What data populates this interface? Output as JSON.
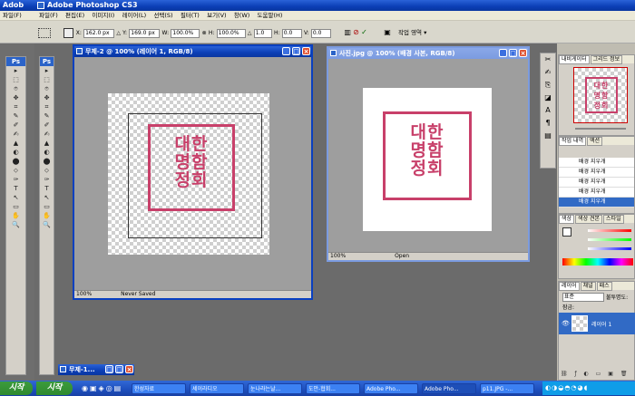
{
  "app_title": "Adobe Photoshop CS3",
  "left_app_title": "Adob",
  "left_app_menu": "파일(F)",
  "menu": [
    "파일(F)",
    "편집(E)",
    "이미지(I)",
    "레이어(L)",
    "선택(S)",
    "필터(T)",
    "보기(V)",
    "창(W)",
    "도움말(H)"
  ],
  "options": {
    "x_label": "X:",
    "x_value": "162.0 px",
    "y_label": "Y:",
    "y_value": "169.0 px",
    "w_label": "W:",
    "w_value": "100.0%",
    "h_label": "H:",
    "h_value": "100.0%",
    "angle_value": "1.0",
    "hskew_label": "H:",
    "hskew_value": "0.0",
    "vskew_label": "V:",
    "vskew_value": "0.0",
    "workspace_label": "작업 영역 ▾"
  },
  "ps_logo": "Ps",
  "tools": [
    "▸",
    "⬚",
    "⌾",
    "✥",
    "⌗",
    "✎",
    "✐",
    "✍",
    "▲",
    "◐",
    "⬤",
    "⬦",
    "✑",
    "T",
    "↖",
    "▭",
    "✋",
    "🔍"
  ],
  "doc1": {
    "title": "무제-2 @ 100% (레이어 1, RGB/8)",
    "zoom": "100%",
    "status": "Never Saved"
  },
  "doc2": {
    "title": "사진.jpg @ 100% (배경 사본, RGB/8)",
    "zoom": "100%",
    "status": "Open"
  },
  "seal_lines": [
    "대한",
    "명함",
    "정회"
  ],
  "minimized_doc": "무제-1...",
  "navigator": {
    "tabs": [
      "내비게이터",
      "그리드 정보"
    ]
  },
  "history": {
    "tabs": [
      "작업 내역",
      "액션"
    ],
    "items": [
      "배경 지우개",
      "배경 지우개",
      "배경 지우개",
      "배경 지우개",
      "배경 지우개"
    ],
    "selected_index": 4
  },
  "color_panel": {
    "tabs": [
      "색상",
      "색상 견본",
      "스타일"
    ]
  },
  "layers": {
    "tabs": [
      "레이어",
      "채널",
      "패스"
    ],
    "blend_mode": "표준",
    "opacity_label": "불투명도:",
    "lock_label": "잠금:",
    "layer_name": "레이어 1"
  },
  "taskbar": {
    "start_left": "시작",
    "start": "시작",
    "items": [
      "한성자료",
      "세이라디오",
      "눈나라는날...",
      "도안-협회...",
      "Adobe Pho...",
      "Adobe Pho...",
      "p11.JPG -..."
    ],
    "active_index": 5
  },
  "colors": {
    "accent": "#0a40c0",
    "seal": "#c8406a",
    "taskbar": "#1d4ebd"
  }
}
